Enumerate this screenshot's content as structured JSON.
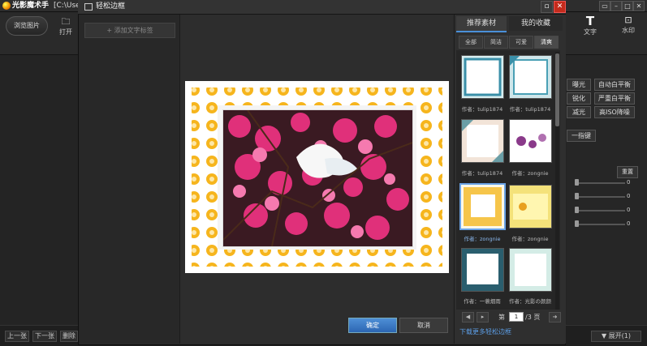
{
  "app": {
    "title": "光影魔术手",
    "path": "[C:\\Use",
    "browse_btn": "浏览图片",
    "open_label": "打开",
    "text_label": "文字",
    "watermark_label": "水印"
  },
  "right_panel": {
    "buttons": [
      "曝光",
      "自动白平衡",
      "锐化",
      "严重白平衡",
      "减光",
      "高ISO降噪",
      "一指键"
    ],
    "reset": "重置",
    "slider_values": [
      "0",
      "0",
      "0",
      "0"
    ]
  },
  "bottom": {
    "prev": "上一张",
    "next": "下一张",
    "delete": "删除",
    "expand": "展开(1)"
  },
  "dialog": {
    "title": "轻松边框",
    "add_tag": "+ 添加文字标签",
    "ok": "确定",
    "cancel": "取消",
    "tabs": [
      "推荐素材",
      "我的收藏"
    ],
    "subtabs": [
      "全部",
      "简洁",
      "可爱",
      "清爽"
    ],
    "authors": [
      "作者：tulip1874",
      "作者：tulip1874",
      "作者：tulip1874",
      "作者：zongnie",
      "作者：zongnie",
      "作者：zongnie",
      "作者：一蓑烟雨",
      "作者：光影の颜颜"
    ],
    "pager": {
      "label_pre": "第",
      "page": "1",
      "label_post": "/3 页"
    },
    "more_link": "下载更多轻松边框"
  }
}
